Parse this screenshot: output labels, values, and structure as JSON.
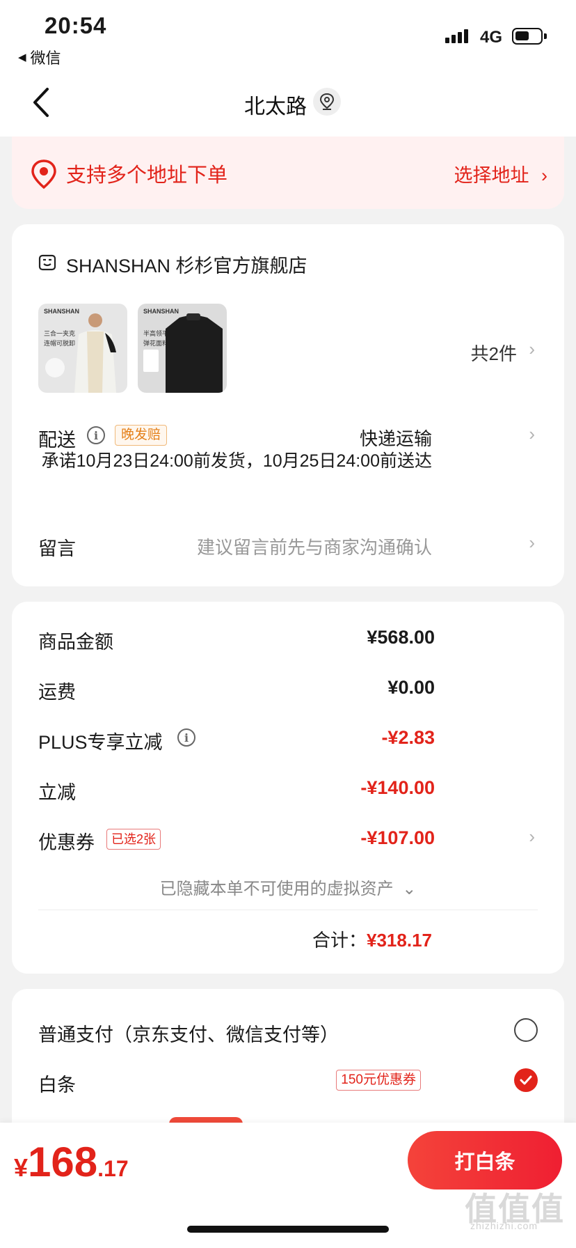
{
  "status": {
    "time": "20:54",
    "back_app": "微信",
    "network": "4G"
  },
  "nav": {
    "title": "北太路"
  },
  "address_banner": {
    "text": "支持多个地址下单",
    "action": "选择地址"
  },
  "store": {
    "name": "SHANSHAN 杉杉官方旗舰店",
    "products": [
      {
        "brand": "SHANSHAN",
        "sub": "三合一夹克",
        "sub2": "连帽可脱卸"
      },
      {
        "brand": "SHANSHAN",
        "sub": "半高领平纹",
        "sub2": "弹花面料"
      }
    ],
    "count_text": "共2件"
  },
  "delivery": {
    "label": "配送",
    "badge": "晚发赔",
    "method": "快递运输",
    "promise": "承诺10月23日24:00前发货，10月25日24:00前送达"
  },
  "message": {
    "label": "留言",
    "placeholder": "建议留言前先与商家沟通确认"
  },
  "summary": {
    "rows": [
      {
        "label": "商品金额",
        "value": "¥568.00"
      },
      {
        "label": "运费",
        "value": "¥0.00"
      },
      {
        "label": "PLUS专享立减",
        "value": "-¥2.83"
      },
      {
        "label": "立减",
        "value": "-¥140.00"
      },
      {
        "label": "优惠券",
        "value": "-¥107.00"
      }
    ],
    "coupon_badge": "已选2张",
    "hidden_assets": "已隐藏本单不可使用的虚拟资产",
    "total_label": "合计：",
    "total_value": "¥318.17"
  },
  "payment": {
    "options": [
      {
        "label": "普通支付（京东支付、微信支付等）",
        "selected": false
      },
      {
        "label": "白条",
        "selected": true
      }
    ],
    "baitiao_badge": "150元优惠券"
  },
  "bottom": {
    "currency": "¥",
    "price_int": "168",
    "price_dec": ".17",
    "button": "打白条"
  },
  "watermark": {
    "main": "值值值",
    "sub": "zhizhizhi.com"
  },
  "colors": {
    "accent": "#e2231a",
    "background": "#f2f2f2"
  }
}
